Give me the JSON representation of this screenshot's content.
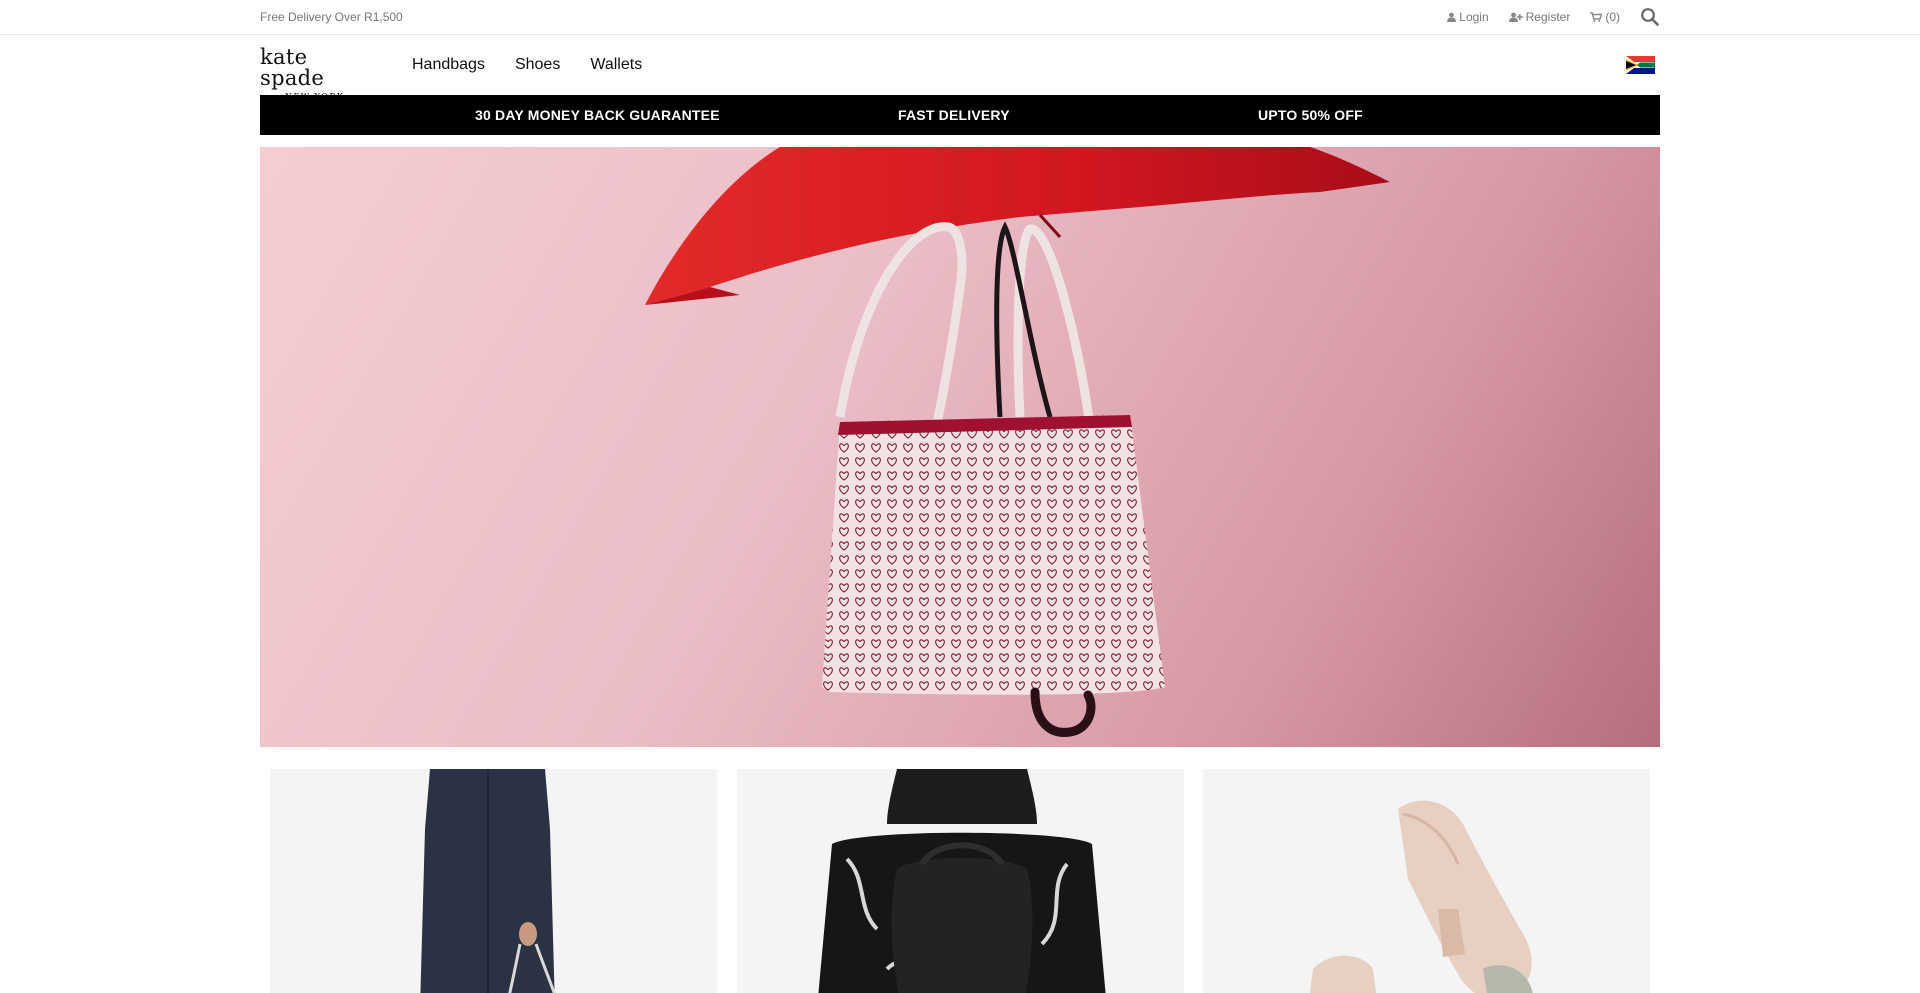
{
  "topbar": {
    "free_delivery": "Free Delivery Over R1,500",
    "login_label": "Login",
    "register_label": "Register",
    "cart_label": "(0)"
  },
  "header": {
    "logo_main": "kate spade",
    "logo_sub": "NEW YORK",
    "nav": [
      "Handbags",
      "Shoes",
      "Wallets"
    ]
  },
  "promo": {
    "items": [
      "30 DAY MONEY BACK GUARANTEE",
      "FAST DELIVERY",
      "UPTO 50% OFF"
    ]
  },
  "icons": {
    "login": "user-icon",
    "register": "user-plus-icon",
    "cart": "cart-icon",
    "search": "search-icon",
    "flag": "south-africa-flag-icon"
  },
  "colors": {
    "promo_bg": "#000000",
    "promo_text": "#ffffff",
    "hero_pink": "#ebbdc6",
    "umbrella_red": "#d9161b",
    "muted_text": "#777777"
  }
}
